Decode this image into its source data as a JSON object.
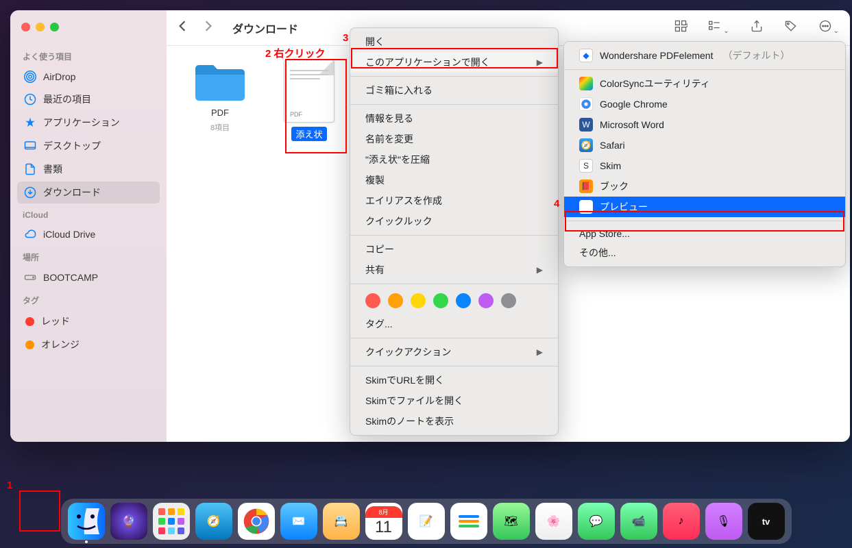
{
  "window": {
    "title": "ダウンロード"
  },
  "sidebar": {
    "section_favorites": "よく使う項目",
    "section_icloud": "iCloud",
    "section_locations": "場所",
    "section_tags": "タグ",
    "airdrop": "AirDrop",
    "recents": "最近の項目",
    "applications": "アプリケーション",
    "desktop": "デスクトップ",
    "documents": "書類",
    "downloads": "ダウンロード",
    "icloud_drive": "iCloud Drive",
    "bootcamp": "BOOTCAMP",
    "tag_red": "レッド",
    "tag_orange": "オレンジ"
  },
  "files": {
    "folder_name": "PDF",
    "folder_sub": "8項目",
    "pdf_name": "添え状"
  },
  "context_menu": {
    "open": "開く",
    "open_with": "このアプリケーションで開く",
    "trash": "ゴミ箱に入れる",
    "get_info": "情報を見る",
    "rename": "名前を変更",
    "compress": "\"添え状\"を圧縮",
    "duplicate": "複製",
    "alias": "エイリアスを作成",
    "quicklook": "クイックルック",
    "copy": "コピー",
    "share": "共有",
    "tags": "タグ...",
    "quick_actions": "クイックアクション",
    "skim_url": "SkimでURLを開く",
    "skim_file": "Skimでファイルを開く",
    "skim_notes": "Skimのノートを表示"
  },
  "open_with_menu": {
    "default_app": "Wondershare PDFelement",
    "default_label": "（デフォルト）",
    "colorsync": "ColorSyncユーティリティ",
    "chrome": "Google Chrome",
    "word": "Microsoft Word",
    "safari": "Safari",
    "skim": "Skim",
    "books": "ブック",
    "preview": "プレビュー",
    "appstore": "App Store...",
    "other": "その他..."
  },
  "annotations": {
    "a1": "1",
    "a2": "2 右クリック",
    "a3": "3",
    "a4": "4"
  },
  "tag_colors": [
    "#ff5b51",
    "#ff9f0a",
    "#ffd60a",
    "#32d74b",
    "#0a84ff",
    "#bf5af2",
    "#8e8e93"
  ],
  "dock": {
    "calendar_month": "8月",
    "calendar_day": "11"
  }
}
